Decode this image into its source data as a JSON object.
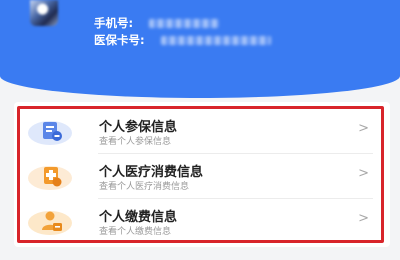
{
  "header": {
    "phone_label": "手机号:",
    "card_label": "医保卡号:"
  },
  "menu": [
    {
      "title": "个人参保信息",
      "subtitle": "查看个人参保信息",
      "icon": "insurance-document-icon"
    },
    {
      "title": "个人医疗消费信息",
      "subtitle": "查看个人医疗消费信息",
      "icon": "medical-expense-icon"
    },
    {
      "title": "个人缴费信息",
      "subtitle": "查看个人缴费信息",
      "icon": "payment-person-icon"
    }
  ],
  "chevron": ">",
  "colors": {
    "header_blue": "#3a7bf2",
    "highlight_red": "#d8242a"
  }
}
